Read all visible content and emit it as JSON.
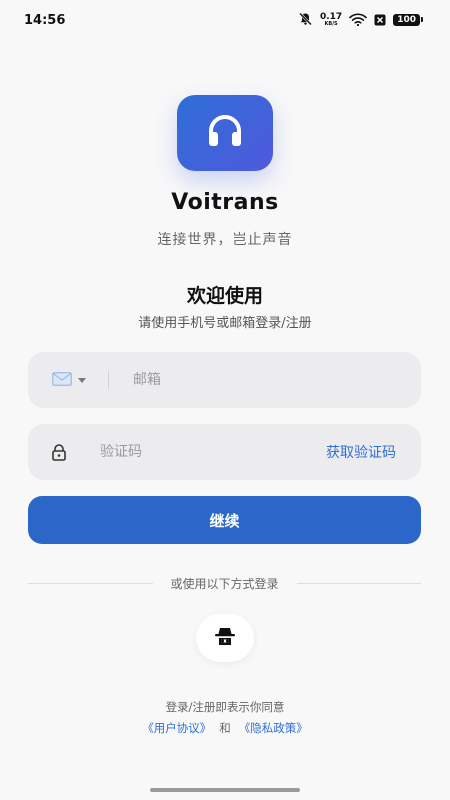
{
  "status_bar": {
    "time": "14:56",
    "net_speed": "0.17",
    "net_unit": "KB/S",
    "battery": "100"
  },
  "app": {
    "name": "Voitrans",
    "tagline": "连接世界，岂止声音",
    "logo_icon": "headphones-icon",
    "brand_color": "#3b66d8"
  },
  "welcome": {
    "title": "欢迎使用",
    "subtitle": "请使用手机号或邮箱登录/注册"
  },
  "form": {
    "account_type_icon": "mail-icon",
    "email_placeholder": "邮箱",
    "email_value": "",
    "code_placeholder": "验证码",
    "code_value": "",
    "get_code_label": "获取验证码",
    "continue_label": "继续"
  },
  "alt_login": {
    "label": "或使用以下方式登录",
    "icon": "incognito-icon"
  },
  "legal": {
    "agree_text": "登录/注册即表示你同意",
    "user_agreement": "《用户协议》",
    "and": "和",
    "privacy_policy": "《隐私政策》"
  },
  "colors": {
    "accent": "#2f6fd6",
    "button": "#2b67c9",
    "field_bg": "#ececee",
    "page_bg": "#f8f8f9"
  }
}
